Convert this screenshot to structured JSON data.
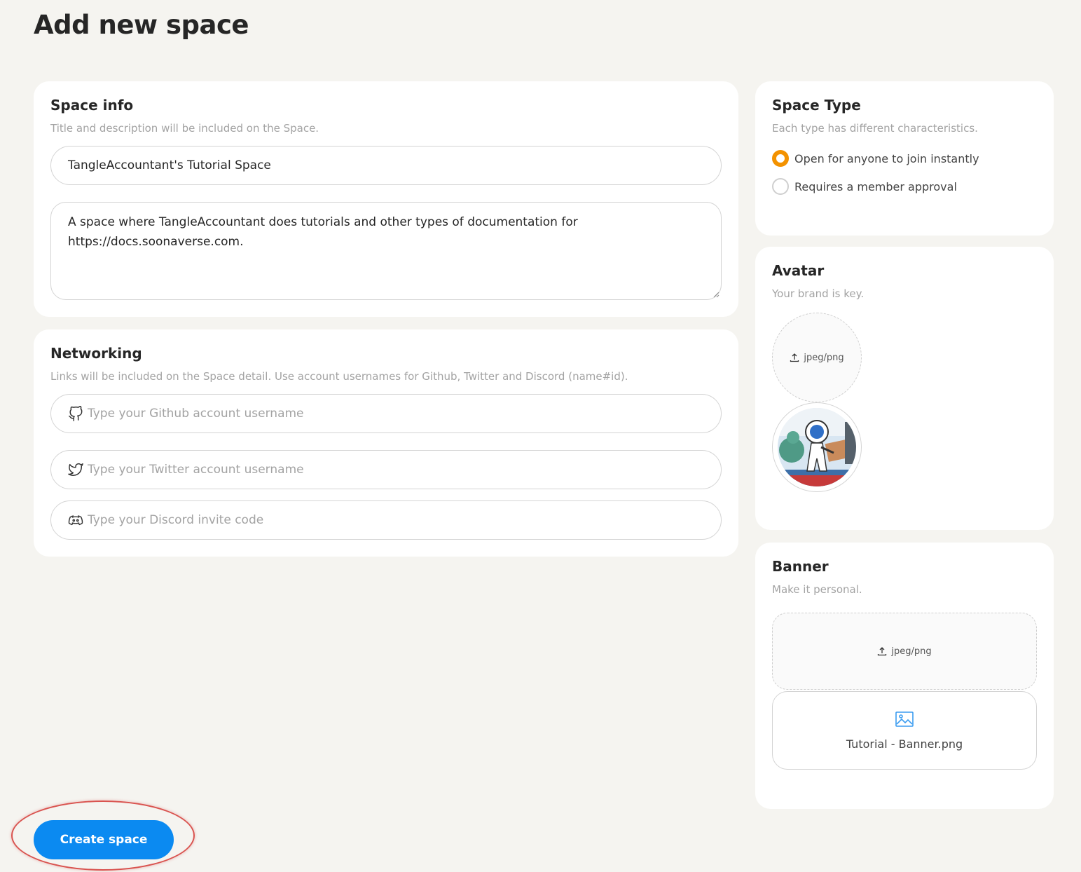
{
  "page": {
    "title": "Add new space"
  },
  "space_info": {
    "title": "Space info",
    "subtitle": "Title and description will be included on the Space.",
    "name_value": "TangleAccountant's Tutorial Space",
    "description_line1": "A space where TangleAccountant does tutorials and other types of documentation for",
    "description_line2": "https://docs.soonaverse.com."
  },
  "networking": {
    "title": "Networking",
    "subtitle": "Links will be included on the Space detail. Use account usernames for Github, Twitter and Discord (name#id).",
    "github_placeholder": "Type your Github account username",
    "twitter_placeholder": "Type your Twitter account username",
    "discord_placeholder": "Type your Discord invite code",
    "icons": [
      "github-icon",
      "twitter-icon",
      "discord-icon"
    ]
  },
  "space_type": {
    "title": "Space Type",
    "subtitle": "Each type has different characteristics.",
    "options": [
      {
        "label": "Open for anyone to join instantly",
        "selected": true
      },
      {
        "label": "Requires a member approval",
        "selected": false
      }
    ]
  },
  "avatar": {
    "title": "Avatar",
    "subtitle": "Your brand is key.",
    "upload_hint": "jpeg/png"
  },
  "banner": {
    "title": "Banner",
    "subtitle": "Make it personal.",
    "upload_hint": "jpeg/png",
    "file_name": "Tutorial - Banner.png"
  },
  "actions": {
    "create_label": "Create space"
  },
  "colors": {
    "background": "#f5f4f0",
    "primary": "#0b8af1",
    "radio_accent": "#f39200",
    "highlight": "#d9534f"
  }
}
